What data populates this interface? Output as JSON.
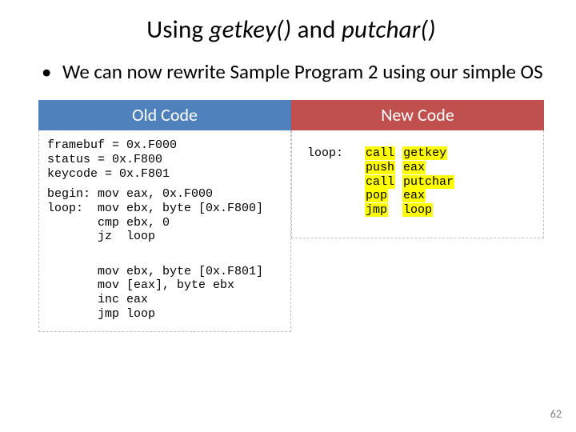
{
  "title": {
    "t1": "Using ",
    "fn1": "getkey()",
    "t2": " and ",
    "fn2": "putchar()"
  },
  "bullet": "We can now rewrite Sample Program 2 using our simple OS",
  "left": {
    "header": "Old Code",
    "defs": "framebuf = 0x.F000\nstatus = 0x.F800\nkeycode = 0x.F801",
    "blk1": "begin: mov eax, 0x.F000\nloop:  mov ebx, byte [0x.F800]\n       cmp ebx, 0\n       jz  loop",
    "blk2": "       mov ebx, byte [0x.F801]\n       mov [eax], byte ebx\n       inc eax\n       jmp loop"
  },
  "right": {
    "header": "New Code",
    "label": "loop:",
    "lines": [
      {
        "op": "call",
        "arg": "getkey"
      },
      {
        "op": "push",
        "arg": "eax"
      },
      {
        "op": "call",
        "arg": "putchar"
      },
      {
        "op": "pop",
        "arg": "eax"
      },
      {
        "op": "jmp",
        "arg": "loop"
      }
    ]
  },
  "page": "62"
}
